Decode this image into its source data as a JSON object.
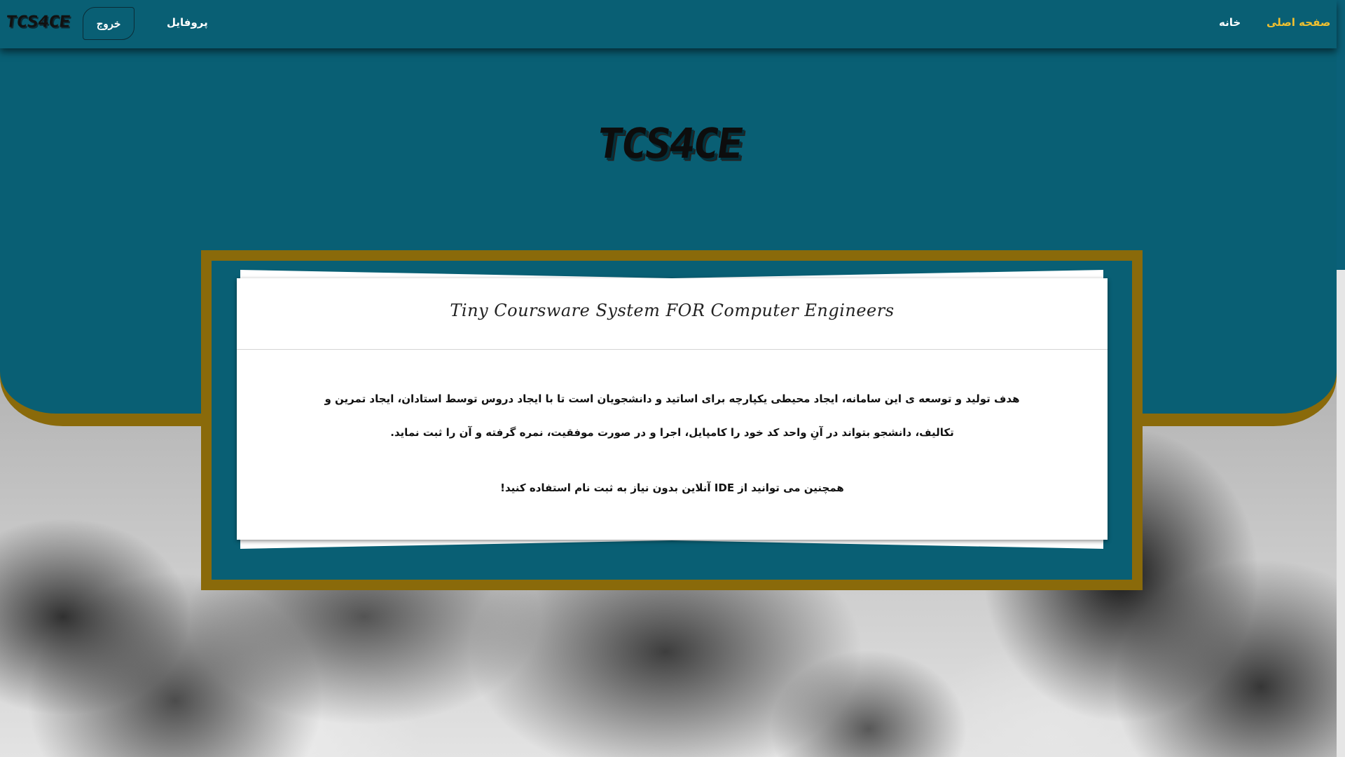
{
  "navbar": {
    "logo_text": "TCS4CE",
    "logout_label": "خروج",
    "profile_label": "پروفایل",
    "home_label": "خانه",
    "main_page_label": "صفحه اصلی"
  },
  "hero": {
    "logo_text": "TCS4CE"
  },
  "card": {
    "title": "Tiny Coursware System FOR Computer Engineers",
    "description": "هدف تولید و توسعه ی این سامانه، ایجاد محیطی یکپارچه برای اساتید و دانشجویان است تا با ایجاد دروس توسط استادان، ایجاد تمرین و تکالیف، دانشجو بتواند در آنِ واحد کد خود را کامپایل، اجرا و در صورت موفقیت، نمره گرفته و آن را ثبت نماید.",
    "ide_note": "همچنین می توانید از IDE آنلاین بدون نیاز به ثبت نام استفاده کنید!"
  },
  "colors": {
    "teal": "#095f74",
    "gold": "#8a6a0a",
    "active_link": "#f0c030"
  }
}
